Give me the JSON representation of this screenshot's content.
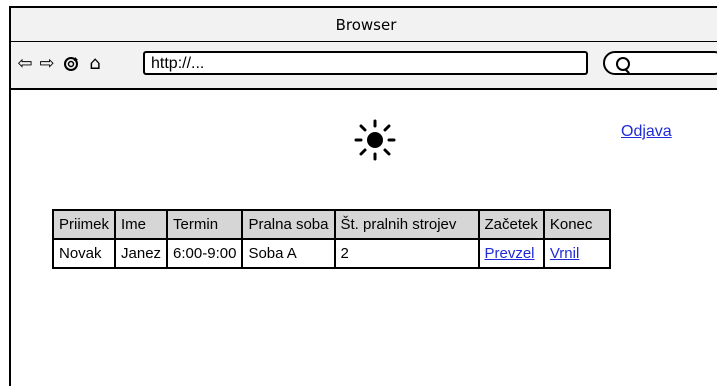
{
  "window": {
    "title": "Browser"
  },
  "toolbar": {
    "icons": [
      "back-arrow-icon",
      "forward-arrow-icon",
      "reload-icon",
      "home-icon"
    ],
    "url_value": "http://...",
    "search_icon": "search-icon"
  },
  "page": {
    "logout_label": "Odjava",
    "logo_icon": "sun-icon",
    "table": {
      "headers": [
        "Priimek",
        "Ime",
        "Termin",
        "Pralna soba",
        "Št. pralnih strojev",
        "Začetek",
        "Konec"
      ],
      "rows": [
        {
          "priimek": "Novak",
          "ime": "Janez",
          "termin": "6:00-9:00",
          "pralna_soba": "Soba A",
          "st_strojev": "2",
          "zacetek": "Prevzel",
          "konec": "Vrnil"
        }
      ]
    }
  },
  "colors": {
    "link": "#1f2bd6",
    "header_bg": "#d6d6d6",
    "chrome_bg": "#f2f2f2"
  }
}
